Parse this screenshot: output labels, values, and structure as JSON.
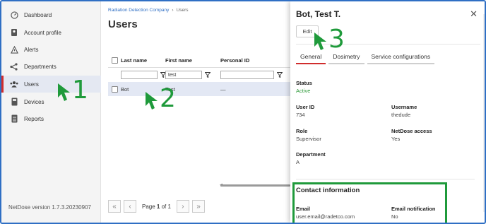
{
  "sidebar": {
    "items": [
      {
        "label": "Dashboard",
        "icon": "dashboard-icon"
      },
      {
        "label": "Account profile",
        "icon": "account-icon"
      },
      {
        "label": "Alerts",
        "icon": "alert-icon"
      },
      {
        "label": "Departments",
        "icon": "departments-icon"
      },
      {
        "label": "Users",
        "icon": "users-icon",
        "active": true
      },
      {
        "label": "Devices",
        "icon": "device-icon"
      },
      {
        "label": "Reports",
        "icon": "reports-icon"
      }
    ],
    "version": "NetDose version 1.7.3.20230907"
  },
  "main": {
    "breadcrumb": {
      "root": "Radiation Detection Company",
      "separator": "›",
      "current": "Users"
    },
    "title": "Users",
    "table": {
      "headers": {
        "last_name": "Last name",
        "first_name": "First name",
        "personal_id": "Personal ID"
      },
      "filters": {
        "last_name": "",
        "first_name": "test",
        "personal_id": ""
      },
      "rows": [
        {
          "last_name": "Bot",
          "first_name": "Test",
          "personal_id": "—"
        }
      ]
    },
    "pager": {
      "label": "Page",
      "current": "1",
      "of": "of",
      "total": "1"
    }
  },
  "panel": {
    "title": "Bot, Test T.",
    "edit_label": "Edit",
    "tabs": [
      "General",
      "Dosimetry",
      "Service configurations"
    ],
    "status": {
      "label": "Status",
      "value": "Active"
    },
    "user_id": {
      "label": "User ID",
      "value": "734"
    },
    "username": {
      "label": "Username",
      "value": "thedude"
    },
    "role": {
      "label": "Role",
      "value": "Supervisor"
    },
    "netdose_access": {
      "label": "NetDose access",
      "value": "Yes"
    },
    "department": {
      "label": "Department",
      "value": "A"
    },
    "contact": {
      "title": "Contact information",
      "email": {
        "label": "Email",
        "value": "user.email@radetco.com"
      },
      "email_notification": {
        "label": "Email notification",
        "value": "No"
      }
    }
  },
  "annotations": {
    "step1": "1",
    "step2": "2",
    "step3": "3"
  },
  "colors": {
    "accent_red": "#d02d2d",
    "link_blue": "#2f6fc4",
    "annotation_green": "#1f9a3b",
    "status_green": "#2e9a3a"
  }
}
